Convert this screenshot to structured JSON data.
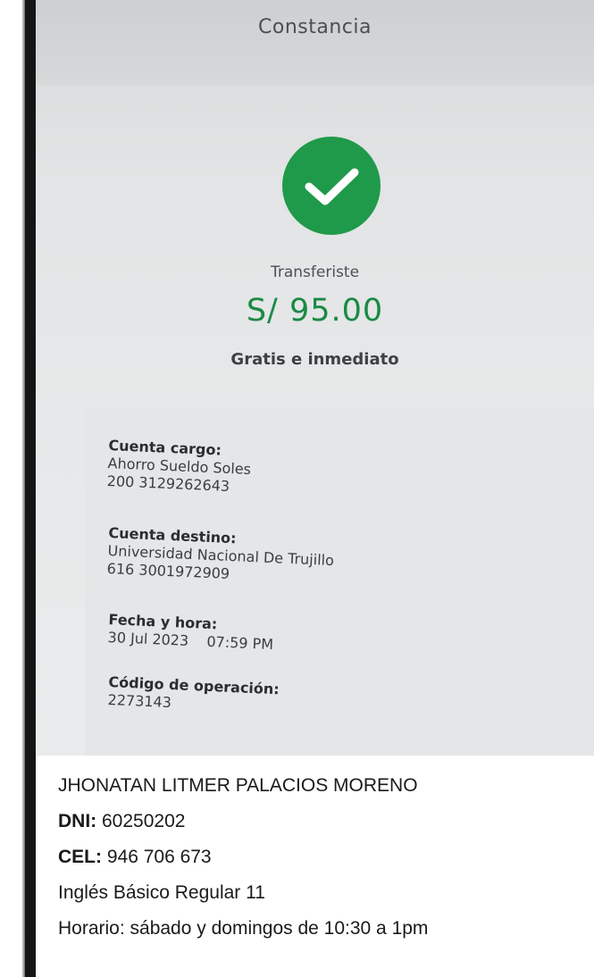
{
  "header": {
    "title": "Constancia"
  },
  "status": {
    "icon": "check-icon",
    "color": "#1f9a4a"
  },
  "transfer": {
    "label": "Transferiste",
    "amount": "S/ 95.00",
    "note": "Gratis e inmediato",
    "amount_color": "#1a8a44"
  },
  "details": [
    {
      "title": "Cuenta cargo:",
      "lines": [
        "Ahorro Sueldo Soles",
        "200 3129262643"
      ]
    },
    {
      "title": "Cuenta destino:",
      "lines": [
        "Universidad Nacional De Trujillo",
        "616 3001972909"
      ]
    },
    {
      "title": "Fecha y hora:",
      "lines": [
        "30 Jul 2023    07:59 PM"
      ]
    },
    {
      "title": "Código de operación:",
      "lines": [
        "2273143"
      ]
    }
  ],
  "student": {
    "name": "JHONATAN LITMER PALACIOS MORENO",
    "dni_label": "DNI:",
    "dni_value": " 60250202",
    "cel_label": "CEL:",
    "cel_value": " 946 706 673",
    "course": "Inglés Básico Regular 11",
    "schedule": "Horario: sábado y domingos de 10:30 a 1pm"
  }
}
